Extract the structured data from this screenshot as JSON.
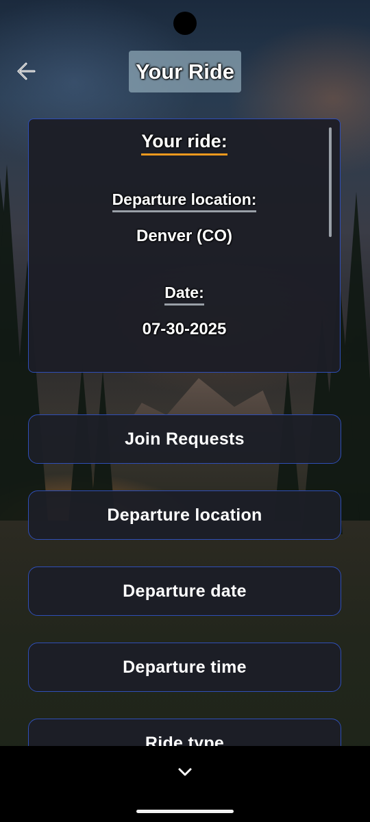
{
  "header": {
    "title": "Your Ride",
    "back_icon": "arrow-left-icon"
  },
  "ride_card": {
    "heading": "Your ride:",
    "departure_location_label": "Departure location:",
    "departure_location_value": "Denver (CO)",
    "date_label": "Date:",
    "date_value": "07-30-2025"
  },
  "actions": [
    {
      "label": "Join Requests"
    },
    {
      "label": "Departure location"
    },
    {
      "label": "Departure date"
    },
    {
      "label": "Departure time"
    },
    {
      "label": "Ride type"
    }
  ],
  "bottom_bar": {
    "icon": "chevron-down-icon"
  },
  "colors": {
    "accent_underline": "#f39a1e",
    "card_border": "#2f4fb8",
    "card_bg": "#1c1e26",
    "title_pill_bg": "#8ca5b4"
  }
}
